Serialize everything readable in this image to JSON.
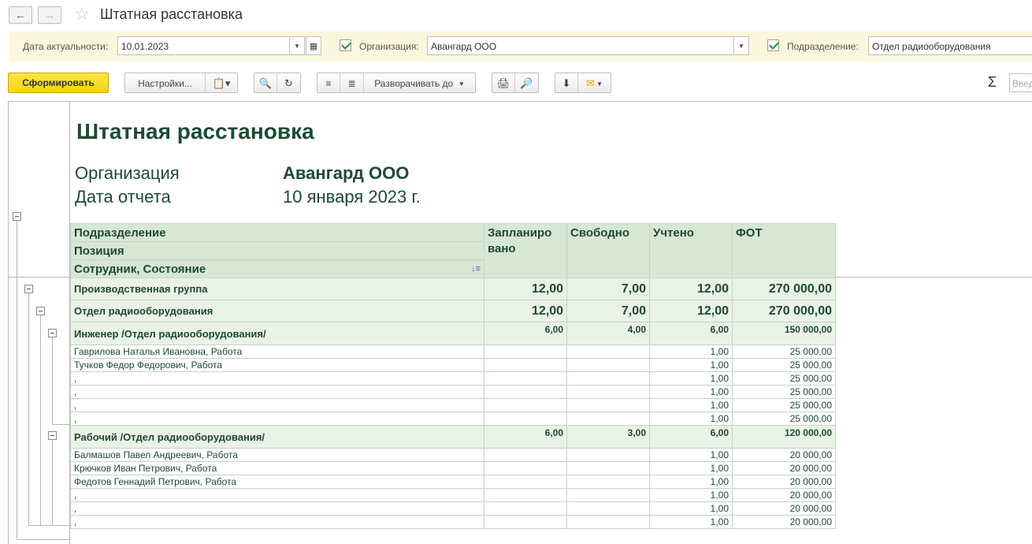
{
  "window": {
    "title": "Штатная расстановка"
  },
  "filters": {
    "date_label": "Дата актуальности:",
    "date_value": "10.01.2023",
    "org_label": "Организация:",
    "org_value": "Авангард ООО",
    "dept_label": "Подразделение:",
    "dept_value": "Отдел радиооборудования"
  },
  "toolbar": {
    "generate": "Сформировать",
    "settings": "Настройки...",
    "expand_to": "Разворачивать до",
    "search_placeholder": "Введ"
  },
  "report": {
    "title": "Штатная расстановка",
    "org_label": "Организация",
    "org_value": "Авангард ООО",
    "date_label": "Дата отчета",
    "date_value": "10 января 2023 г.",
    "headers": {
      "dept": "Подразделение",
      "position": "Позиция",
      "employee": "Сотрудник, Состояние",
      "planned": "Запланиро\nвано",
      "free": "Свободно",
      "counted": "Учтено",
      "fot": "ФОТ"
    },
    "rows": [
      {
        "level": 1,
        "name": "Производственная группа",
        "planned": "12,00",
        "free": "7,00",
        "counted": "12,00",
        "fot": "270 000,00"
      },
      {
        "level": 1,
        "name": "Отдел радиооборудования",
        "planned": "12,00",
        "free": "7,00",
        "counted": "12,00",
        "fot": "270 000,00"
      },
      {
        "level": 2,
        "name": "Инженер /Отдел радиооборудования/",
        "planned": "6,00",
        "free": "4,00",
        "counted": "6,00",
        "fot": "150 000,00"
      },
      {
        "level": 3,
        "name": "Гаврилова Наталья Ивановна, Работа",
        "planned": "",
        "free": "",
        "counted": "1,00",
        "fot": "25 000,00"
      },
      {
        "level": 3,
        "name": "Тучков Федор Федорович, Работа",
        "planned": "",
        "free": "",
        "counted": "1,00",
        "fot": "25 000,00"
      },
      {
        "level": 3,
        "name": ",",
        "planned": "",
        "free": "",
        "counted": "1,00",
        "fot": "25 000,00"
      },
      {
        "level": 3,
        "name": ",",
        "planned": "",
        "free": "",
        "counted": "1,00",
        "fot": "25 000,00"
      },
      {
        "level": 3,
        "name": ",",
        "planned": "",
        "free": "",
        "counted": "1,00",
        "fot": "25 000,00"
      },
      {
        "level": 3,
        "name": ",",
        "planned": "",
        "free": "",
        "counted": "1,00",
        "fot": "25 000,00"
      },
      {
        "level": 2,
        "name": "Рабочий /Отдел радиооборудования/",
        "planned": "6,00",
        "free": "3,00",
        "counted": "6,00",
        "fot": "120 000,00"
      },
      {
        "level": 3,
        "name": "Балмашов Павел Андреевич, Работа",
        "planned": "",
        "free": "",
        "counted": "1,00",
        "fot": "20 000,00"
      },
      {
        "level": 3,
        "name": "Крючков Иван Петрович, Работа",
        "planned": "",
        "free": "",
        "counted": "1,00",
        "fot": "20 000,00"
      },
      {
        "level": 3,
        "name": "Федотов Геннадий Петрович, Работа",
        "planned": "",
        "free": "",
        "counted": "1,00",
        "fot": "20 000,00"
      },
      {
        "level": 3,
        "name": ",",
        "planned": "",
        "free": "",
        "counted": "1,00",
        "fot": "20 000,00"
      },
      {
        "level": 3,
        "name": ",",
        "planned": "",
        "free": "",
        "counted": "1,00",
        "fot": "20 000,00"
      },
      {
        "level": 3,
        "name": ",",
        "planned": "",
        "free": "",
        "counted": "1,00",
        "fot": "20 000,00"
      }
    ]
  }
}
